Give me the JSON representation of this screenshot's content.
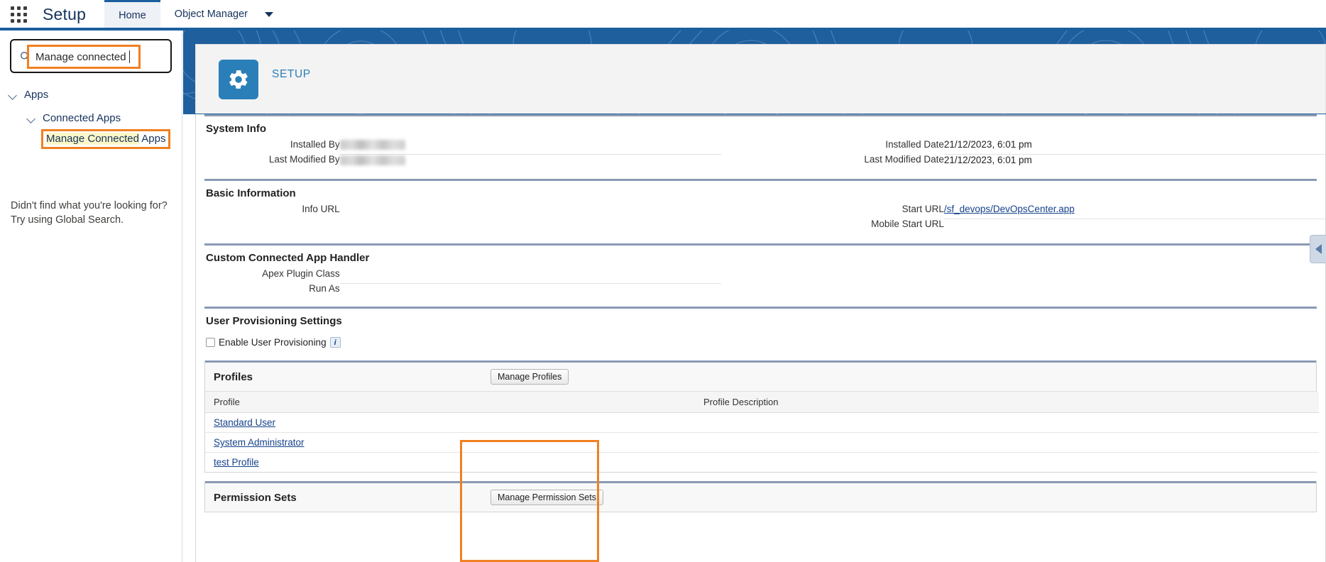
{
  "header": {
    "app_launcher": "app-launcher",
    "title": "Setup",
    "tabs": [
      {
        "label": "Home",
        "active": true
      },
      {
        "label": "Object Manager",
        "active": false
      }
    ]
  },
  "sidebar": {
    "search": {
      "value": "Manage connected",
      "placeholder": "Quick Find"
    },
    "tree": [
      {
        "label": "Apps",
        "level": 1,
        "expanded": true
      },
      {
        "label": "Connected Apps",
        "level": 2,
        "expanded": true
      }
    ],
    "selected_item": {
      "highlighted_text": "Manage Connected",
      "rest_text": " Apps"
    },
    "footer_note_line1": "Didn't find what you're looking for?",
    "footer_note_line2": "Try using Global Search."
  },
  "setup_banner": {
    "icon": "gear-icon",
    "label": "SETUP"
  },
  "sections": {
    "system_info": {
      "title": "System Info",
      "rows": [
        {
          "label": "Installed By",
          "value": "",
          "blurred": true,
          "right_label": "Installed Date",
          "right_value": "21/12/2023, 6:01 pm"
        },
        {
          "label": "Last Modified By",
          "value": "",
          "blurred": true,
          "right_label": "Last Modified Date",
          "right_value": "21/12/2023, 6:01 pm"
        }
      ]
    },
    "basic_information": {
      "title": "Basic Information",
      "rows": [
        {
          "label": "Info URL",
          "value": "",
          "right_label": "Start URL",
          "right_value": "/sf_devops/DevOpsCenter.app",
          "right_is_link": true
        },
        {
          "label": "",
          "value": "",
          "right_label": "Mobile Start URL",
          "right_value": ""
        }
      ]
    },
    "custom_connected_app_handler": {
      "title": "Custom Connected App Handler",
      "rows": [
        {
          "label": "Apex Plugin Class",
          "value": ""
        },
        {
          "label": "Run As",
          "value": ""
        }
      ]
    },
    "user_provisioning_settings": {
      "title": "User Provisioning Settings",
      "checkbox_label": "Enable User Provisioning",
      "checkbox_checked": false,
      "info_icon": "info-icon"
    }
  },
  "profiles_list": {
    "title": "Profiles",
    "button": "Manage Profiles",
    "columns": [
      "Profile",
      "Profile Description"
    ],
    "rows": [
      {
        "profile": "Standard User",
        "description": ""
      },
      {
        "profile": "System Administrator",
        "description": ""
      },
      {
        "profile": "test Profile",
        "description": ""
      }
    ]
  },
  "permission_sets_list": {
    "title": "Permission Sets",
    "button": "Manage Permission Sets"
  },
  "right_panel_toggle": {
    "icon": "chevron-left-icon"
  },
  "colors": {
    "brand_blue": "#1f5f9e",
    "link_blue": "#15428b",
    "highlight_orange": "#f08022",
    "highlight_yellow": "#fbf7c7",
    "section_rule": "#8a9ab5"
  }
}
